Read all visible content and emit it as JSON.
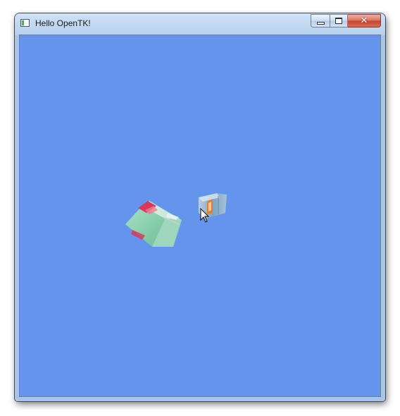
{
  "window": {
    "title": "Hello OpenTK!",
    "client_background": "#6495ed"
  },
  "titlebar": {
    "icon": "app-window-icon",
    "buttons": [
      {
        "name": "minimize",
        "icon": "minimize-icon"
      },
      {
        "name": "maximize",
        "icon": "maximize-icon"
      },
      {
        "name": "close",
        "icon": "close-icon"
      }
    ]
  },
  "scene": {
    "objects": [
      {
        "name": "large-textured-cube",
        "colors": [
          "#8fd3b4",
          "#d9375b"
        ]
      },
      {
        "name": "small-textured-cube",
        "colors": [
          "#8fb0c8",
          "#e07b2f"
        ]
      }
    ],
    "cursor": "arrow-cursor-icon"
  }
}
